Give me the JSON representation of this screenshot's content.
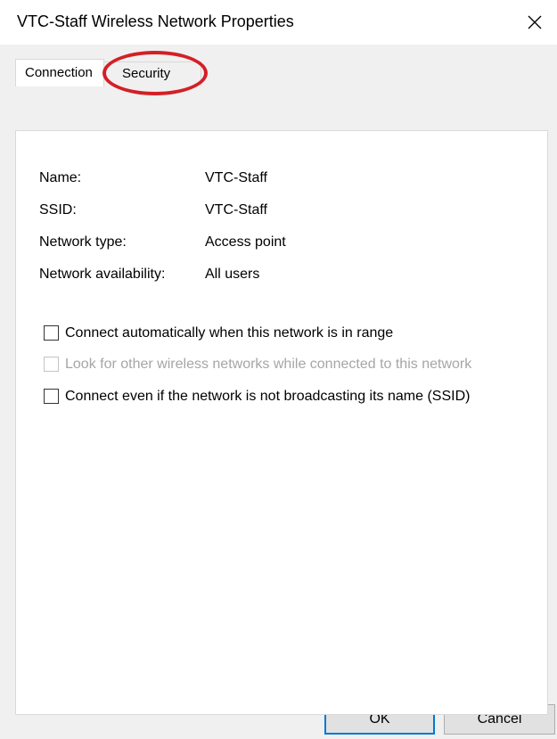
{
  "window": {
    "title": "VTC-Staff Wireless Network Properties",
    "close_icon": "close-icon"
  },
  "tabs": [
    {
      "label": "Connection",
      "selected": true
    },
    {
      "label": "Security",
      "selected": false,
      "highlighted": true
    }
  ],
  "annotation": {
    "highlight_color": "#d41f26"
  },
  "info": [
    {
      "label": "Name:",
      "value": "VTC-Staff"
    },
    {
      "label": "SSID:",
      "value": "VTC-Staff"
    },
    {
      "label": "Network type:",
      "value": "Access point"
    },
    {
      "label": "Network availability:",
      "value": "All users"
    }
  ],
  "options": [
    {
      "label": "Connect automatically when this network is in range",
      "checked": false,
      "enabled": true
    },
    {
      "label": "Look for other wireless networks while connected to this network",
      "checked": false,
      "enabled": false
    },
    {
      "label": "Connect even if the network is not broadcasting its name (SSID)",
      "checked": false,
      "enabled": true
    }
  ],
  "buttons": {
    "ok_label": "OK",
    "cancel_label": "Cancel"
  },
  "colors": {
    "default_button_border": "#0078d7",
    "disabled_text": "#a6a6a6"
  }
}
